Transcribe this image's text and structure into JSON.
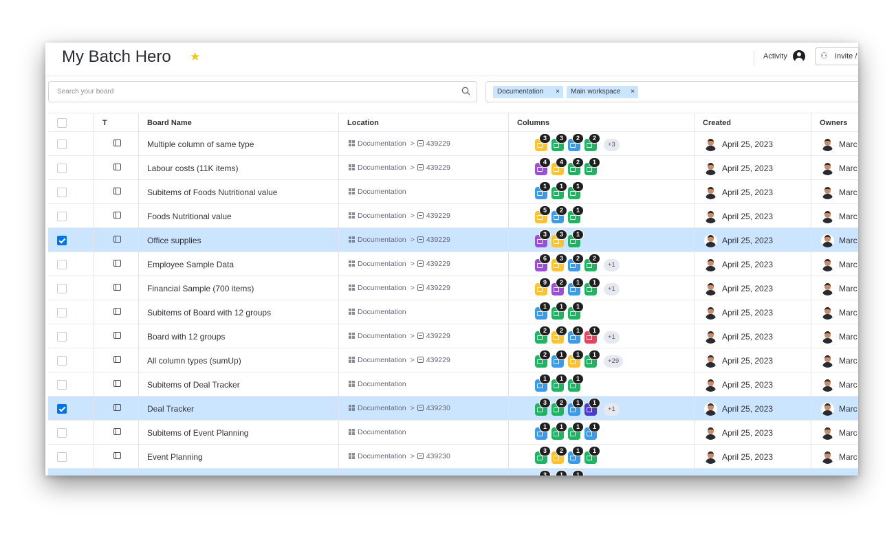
{
  "header": {
    "title": "My Batch Hero",
    "activity_label": "Activity",
    "invite_label": "Invite /"
  },
  "search": {
    "placeholder": "Search your board"
  },
  "filters": {
    "chips": [
      "Documentation",
      "Main workspace"
    ]
  },
  "columns_header": {
    "type": "T",
    "board_name": "Board Name",
    "location": "Location",
    "columns": "Columns",
    "created": "Created",
    "owners": "Owners"
  },
  "colors": {
    "yellow": "#fdc42f",
    "blue": "#3b9be8",
    "green": "#1fb461",
    "purple": "#9c4fd6",
    "red": "#e8435a",
    "navy": "#4b3ccc",
    "selected_row": "#cce5ff",
    "checkbox": "#0073ea",
    "star": "#f5c518"
  },
  "rows": [
    {
      "name": "Multiple column of same type",
      "workspace": "Documentation",
      "board_id": "439229",
      "selected": false,
      "cols": [
        {
          "c": "yellow",
          "n": "3"
        },
        {
          "c": "green",
          "n": "3"
        },
        {
          "c": "blue",
          "n": "2"
        },
        {
          "c": "green",
          "n": "2"
        }
      ],
      "more": "+3",
      "created": "April 25, 2023",
      "owner": "Marc"
    },
    {
      "name": "Labour costs (11K items)",
      "workspace": "Documentation",
      "board_id": "439229",
      "selected": false,
      "cols": [
        {
          "c": "purple",
          "n": "4"
        },
        {
          "c": "yellow",
          "n": "4"
        },
        {
          "c": "green",
          "n": "2"
        },
        {
          "c": "green",
          "n": "1"
        }
      ],
      "more": "",
      "created": "April 25, 2023",
      "owner": "Marc"
    },
    {
      "name": "Subitems of Foods Nutritional value",
      "workspace": "Documentation",
      "board_id": "",
      "selected": false,
      "cols": [
        {
          "c": "blue",
          "n": "1"
        },
        {
          "c": "green",
          "n": "1"
        },
        {
          "c": "green",
          "n": "1"
        }
      ],
      "more": "",
      "created": "April 25, 2023",
      "owner": "Marc"
    },
    {
      "name": "Foods Nutritional value",
      "workspace": "Documentation",
      "board_id": "439229",
      "selected": false,
      "cols": [
        {
          "c": "yellow",
          "n": "5"
        },
        {
          "c": "blue",
          "n": "2"
        },
        {
          "c": "green",
          "n": "1"
        }
      ],
      "more": "",
      "created": "April 25, 2023",
      "owner": "Marc"
    },
    {
      "name": "Office supplies",
      "workspace": "Documentation",
      "board_id": "439229",
      "selected": true,
      "cols": [
        {
          "c": "purple",
          "n": "3"
        },
        {
          "c": "yellow",
          "n": "3"
        },
        {
          "c": "green",
          "n": "1"
        }
      ],
      "more": "",
      "created": "April 25, 2023",
      "owner": "Marc"
    },
    {
      "name": "Employee Sample Data",
      "workspace": "Documentation",
      "board_id": "439229",
      "selected": false,
      "cols": [
        {
          "c": "purple",
          "n": "6"
        },
        {
          "c": "yellow",
          "n": "3"
        },
        {
          "c": "blue",
          "n": "2"
        },
        {
          "c": "green",
          "n": "2"
        }
      ],
      "more": "+1",
      "created": "April 25, 2023",
      "owner": "Marc"
    },
    {
      "name": "Financial Sample (700 items)",
      "workspace": "Documentation",
      "board_id": "439229",
      "selected": false,
      "cols": [
        {
          "c": "yellow",
          "n": "9"
        },
        {
          "c": "purple",
          "n": "2"
        },
        {
          "c": "blue",
          "n": "1"
        },
        {
          "c": "green",
          "n": "1"
        }
      ],
      "more": "+1",
      "created": "April 25, 2023",
      "owner": "Marc"
    },
    {
      "name": "Subitems of Board with 12 groups",
      "workspace": "Documentation",
      "board_id": "",
      "selected": false,
      "cols": [
        {
          "c": "blue",
          "n": "1"
        },
        {
          "c": "green",
          "n": "1"
        },
        {
          "c": "green",
          "n": "1"
        }
      ],
      "more": "",
      "created": "April 25, 2023",
      "owner": "Marc"
    },
    {
      "name": "Board with 12 groups",
      "workspace": "Documentation",
      "board_id": "439229",
      "selected": false,
      "cols": [
        {
          "c": "green",
          "n": "2"
        },
        {
          "c": "yellow",
          "n": "2"
        },
        {
          "c": "blue",
          "n": "1"
        },
        {
          "c": "red",
          "n": "1"
        }
      ],
      "more": "+1",
      "created": "April 25, 2023",
      "owner": "Marc"
    },
    {
      "name": "All column types (sumUp)",
      "workspace": "Documentation",
      "board_id": "439229",
      "selected": false,
      "cols": [
        {
          "c": "green",
          "n": "2"
        },
        {
          "c": "blue",
          "n": "1"
        },
        {
          "c": "yellow",
          "n": "1"
        },
        {
          "c": "green",
          "n": "1"
        }
      ],
      "more": "+29",
      "created": "April 25, 2023",
      "owner": "Marc"
    },
    {
      "name": "Subitems of Deal Tracker",
      "workspace": "Documentation",
      "board_id": "",
      "selected": false,
      "cols": [
        {
          "c": "blue",
          "n": "1"
        },
        {
          "c": "green",
          "n": "1"
        },
        {
          "c": "green",
          "n": "1"
        }
      ],
      "more": "",
      "created": "April 25, 2023",
      "owner": "Marc"
    },
    {
      "name": "Deal Tracker",
      "workspace": "Documentation",
      "board_id": "439230",
      "selected": true,
      "cols": [
        {
          "c": "green",
          "n": "3"
        },
        {
          "c": "green",
          "n": "2"
        },
        {
          "c": "blue",
          "n": "1"
        },
        {
          "c": "navy",
          "n": "1"
        }
      ],
      "more": "+1",
      "created": "April 25, 2023",
      "owner": "Marc"
    },
    {
      "name": "Subitems of Event Planning",
      "workspace": "Documentation",
      "board_id": "",
      "selected": false,
      "cols": [
        {
          "c": "blue",
          "n": "1"
        },
        {
          "c": "green",
          "n": "1"
        },
        {
          "c": "green",
          "n": "1"
        },
        {
          "c": "blue",
          "n": "1"
        }
      ],
      "more": "",
      "created": "April 25, 2023",
      "owner": "Marc"
    },
    {
      "name": "Event Planning",
      "workspace": "Documentation",
      "board_id": "439230",
      "selected": false,
      "cols": [
        {
          "c": "green",
          "n": "3"
        },
        {
          "c": "yellow",
          "n": "2"
        },
        {
          "c": "blue",
          "n": "1"
        },
        {
          "c": "green",
          "n": "1"
        }
      ],
      "more": "",
      "created": "April 25, 2023",
      "owner": "Marc"
    },
    {
      "name": "",
      "workspace": "",
      "board_id": "",
      "selected": true,
      "cols": [
        {
          "c": "purple",
          "n": "3"
        },
        {
          "c": "purple",
          "n": "1"
        },
        {
          "c": "green",
          "n": "1"
        }
      ],
      "more": "",
      "created": "",
      "owner": ""
    }
  ]
}
